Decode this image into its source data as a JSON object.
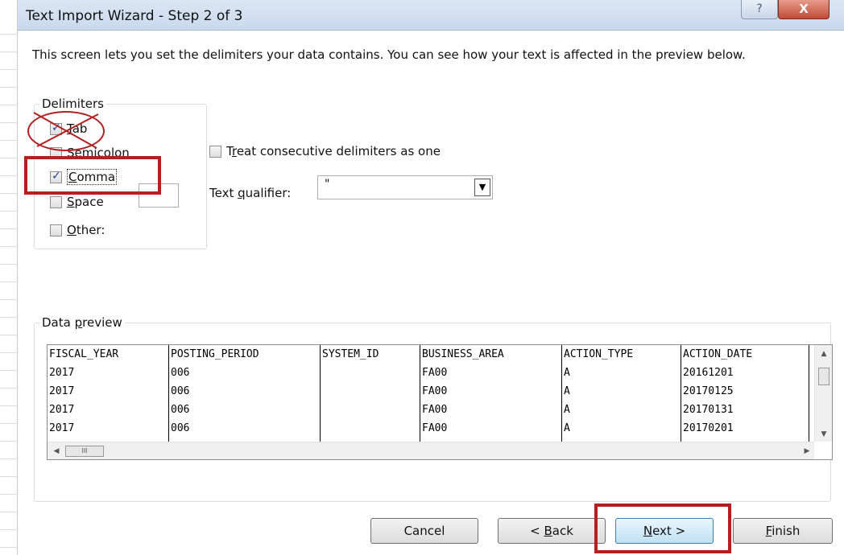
{
  "window": {
    "title": "Text Import Wizard - Step 2 of 3",
    "help_glyph": "?",
    "close_glyph": "X"
  },
  "description": "This screen lets you set the delimiters your data contains.  You can see how your text is affected in the preview below.",
  "delimiters": {
    "legend": "Delimiters",
    "tab": {
      "label_first": "T",
      "label_rest": "ab",
      "checked": true
    },
    "semicolon": {
      "label_first": "Se",
      "label_u": "m",
      "label_rest": "icolon",
      "checked": false
    },
    "comma": {
      "label_first": "",
      "label_u": "C",
      "label_rest": "omma",
      "checked": true
    },
    "space": {
      "label_first": "",
      "label_u": "S",
      "label_rest": "pace",
      "checked": false
    },
    "other": {
      "label_u": "O",
      "label_rest": "ther:",
      "checked": false,
      "value": ""
    }
  },
  "options": {
    "treat_consecutive": {
      "label_first": "T",
      "label_u": "r",
      "label_rest": "eat consecutive delimiters as one",
      "checked": false
    },
    "text_qualifier": {
      "label_first": "Text ",
      "label_u": "q",
      "label_rest": "ualifier:",
      "value": "\""
    }
  },
  "preview": {
    "legend_first": "Data ",
    "legend_u": "p",
    "legend_rest": "review",
    "columns": [
      {
        "header": "FISCAL_YEAR",
        "rows": [
          "2017",
          "2017",
          "2017",
          "2017"
        ]
      },
      {
        "header": "POSTING_PERIOD",
        "rows": [
          "006",
          "006",
          "006",
          "006"
        ]
      },
      {
        "header": "SYSTEM_ID",
        "rows": [
          "",
          "",
          "",
          ""
        ]
      },
      {
        "header": "BUSINESS_AREA",
        "rows": [
          "FA00",
          "FA00",
          "FA00",
          "FA00"
        ]
      },
      {
        "header": "ACTION_TYPE",
        "rows": [
          "A",
          "A",
          "A",
          "A"
        ]
      },
      {
        "header": "ACTION_DATE",
        "rows": [
          "20161201",
          "20170125",
          "20170131",
          "20170201"
        ]
      }
    ],
    "scroll_thumb_glyph": "III"
  },
  "buttons": {
    "cancel": "Cancel",
    "back": {
      "prefix": "< ",
      "u": "B",
      "rest": "ack"
    },
    "next": {
      "u": "N",
      "rest": "ext >"
    },
    "finish": {
      "u": "F",
      "rest": "inish"
    }
  },
  "colors": {
    "annotation": "#b41f1f",
    "title_bar": "#c9d9ee",
    "close_button": "#c14b37",
    "next_button_border": "#3c7fb1"
  }
}
